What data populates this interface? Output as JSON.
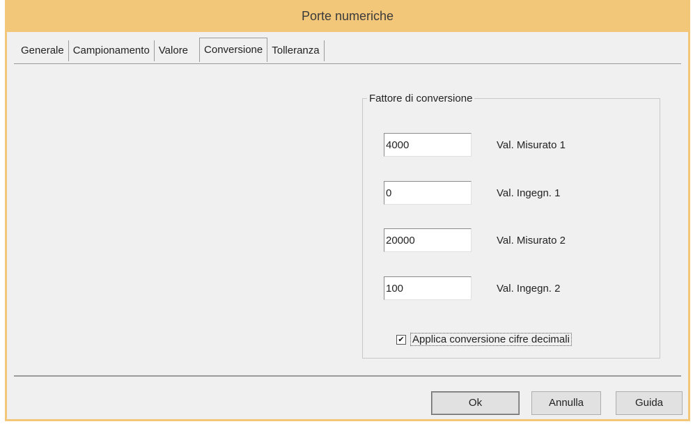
{
  "window": {
    "title": "Porte numeriche"
  },
  "tabs": [
    {
      "label": "Generale",
      "active": false
    },
    {
      "label": "Campionamento",
      "active": false
    },
    {
      "label": "Valore",
      "active": false
    },
    {
      "label": "Conversione",
      "active": true
    },
    {
      "label": "Tolleranza",
      "active": false
    }
  ],
  "conversion_group": {
    "title": "Fattore di conversione",
    "fields": [
      {
        "value": "4000",
        "label": "Val. Misurato 1"
      },
      {
        "value": "0",
        "label": "Val. Ingegn. 1"
      },
      {
        "value": "20000",
        "label": "Val. Misurato 2"
      },
      {
        "value": "100",
        "label": "Val. Ingegn. 2"
      }
    ],
    "checkbox": {
      "label": "Applica conversione cifre decimali",
      "checked": true,
      "mark": "✔"
    }
  },
  "buttons": {
    "ok": "Ok",
    "cancel": "Annulla",
    "help": "Guida"
  },
  "colors": {
    "title_bar": "#f3c77a",
    "dialog_bg": "#f0f0f0"
  }
}
